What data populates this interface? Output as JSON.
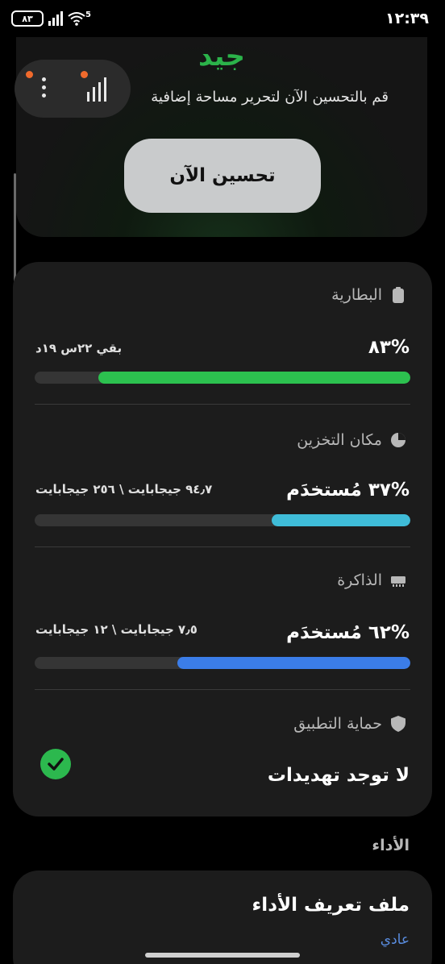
{
  "status_bar": {
    "time": "١٢:٣٩",
    "battery": "٨٣",
    "network_badge": "5"
  },
  "header": {
    "status_word": "جيد",
    "subtitle": "قم بالتحسين الآن لتحرير مساحة إضافية",
    "optimize_button": "تحسين الآن"
  },
  "battery": {
    "label": "البطارية",
    "percent_text": "%٨٣",
    "remaining_text": "بقي ٢٢س ١٩د",
    "level": 0.83,
    "color": "#2cc14f",
    "icon": "battery-icon"
  },
  "storage": {
    "label": "مكان التخزين",
    "used_text": "%٣٧ مُستخدَم",
    "detail_text": "٩٤٫٧ جيجابايت \\ ٢٥٦ جيجابايت",
    "level": 0.37,
    "color": "#3fbcd8",
    "icon": "storage-pie-icon"
  },
  "memory": {
    "label": "الذاكرة",
    "used_text": "%٦٢ مُستخدَم",
    "detail_text": "٧٫٥ جيجابايت \\ ١٢ جيجابايت",
    "level": 0.62,
    "color": "#3b7de8",
    "icon": "memory-chip-icon"
  },
  "app_protection": {
    "label": "حماية التطبيق",
    "status_text": "لا توجد تهديدات",
    "icon": "shield-icon",
    "status_color": "#2cb84e"
  },
  "performance": {
    "section_label": "الأداء",
    "profile_title": "ملف تعريف الأداء",
    "profile_value": "عادي"
  }
}
